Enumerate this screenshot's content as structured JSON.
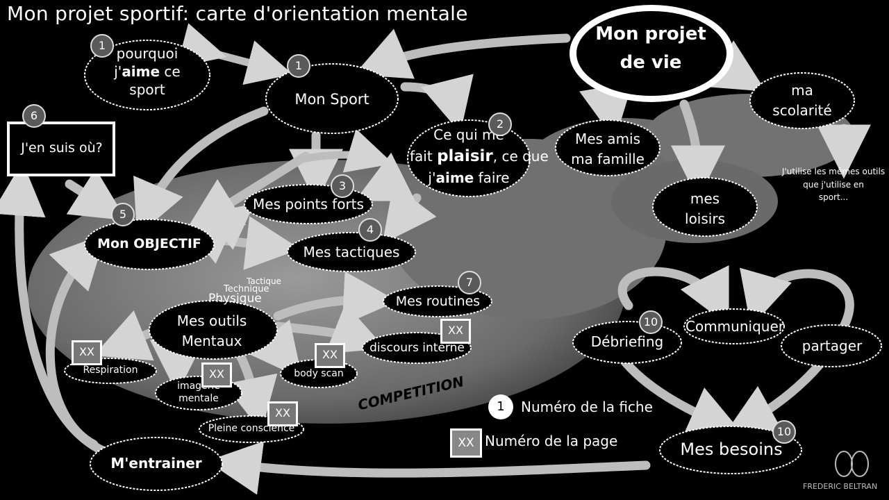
{
  "title": "Mon projet sportif: carte d'orientation mentale",
  "center": {
    "line1": "Mon projet",
    "line2": "de vie"
  },
  "nodes": {
    "pourquoi": {
      "l1": "pourquoi",
      "l2a": "j'",
      "l2b": "aime",
      "l2c": " ce",
      "l3": "sport"
    },
    "mon_sport": "Mon Sport",
    "plaisir": {
      "l1": "Ce qui me",
      "l2a": "fait ",
      "l2b": "plaisir",
      "l2c": ", ce que",
      "l3a": "j'",
      "l3b": "aime",
      "l3c": " faire"
    },
    "ou_en_suis": "J'en suis où?",
    "points_forts": "Mes points forts",
    "objectif": "Mon OBJECTIF",
    "tactiques": "Mes tactiques",
    "amis": {
      "l1": "Mes amis",
      "l2": "ma famille"
    },
    "loisirs": {
      "l1": "mes",
      "l2": "loisirs"
    },
    "scolarite": {
      "l1": "ma",
      "l2": "scolarité"
    },
    "scolarite_note": {
      "l1": "J'utilise les mêmes outils",
      "l2": "que j'utilise en",
      "l3": "sport..."
    },
    "routines": "Mes routines",
    "outils": {
      "l1": "Mes outils",
      "l2": "Mentaux"
    },
    "tactique_lbl": "Tactique",
    "technique_lbl": "Technique",
    "physique_lbl": "Physique",
    "discours": "discours interne",
    "respiration": "Respiration",
    "imagerie": {
      "l1": "imagerie",
      "l2": "mentale"
    },
    "body_scan": "body scan",
    "pleine": "Pleine conscience",
    "competition": "COMPETITION",
    "debriefing": "Débriefing",
    "communiquer": "Communiquer",
    "partager": "partager",
    "besoins": "Mes besoins",
    "entrainer": "M'entrainer"
  },
  "badges": {
    "pourquoi": "1",
    "mon_sport": "1",
    "plaisir": "2",
    "points_forts": "3",
    "tactiques": "4",
    "objectif": "5",
    "ou_en_suis": "6",
    "routines": "7",
    "debriefing": "10",
    "besoins": "10"
  },
  "page_marks": {
    "respiration": "XX",
    "imagerie": "XX",
    "body_scan": "XX",
    "pleine": "XX",
    "discours": "XX"
  },
  "legend": {
    "num_symbol": "1",
    "num_label": "Numéro de la fiche",
    "page_symbol": "XX",
    "page_label": "Numéro de la page"
  },
  "signature": "FREDERIC BELTRAN",
  "colors": {
    "background": "#000000",
    "cloud": "#6e6e6e",
    "node": "#000000",
    "arrow": "#bdbdbd",
    "text": "#ffffff"
  }
}
